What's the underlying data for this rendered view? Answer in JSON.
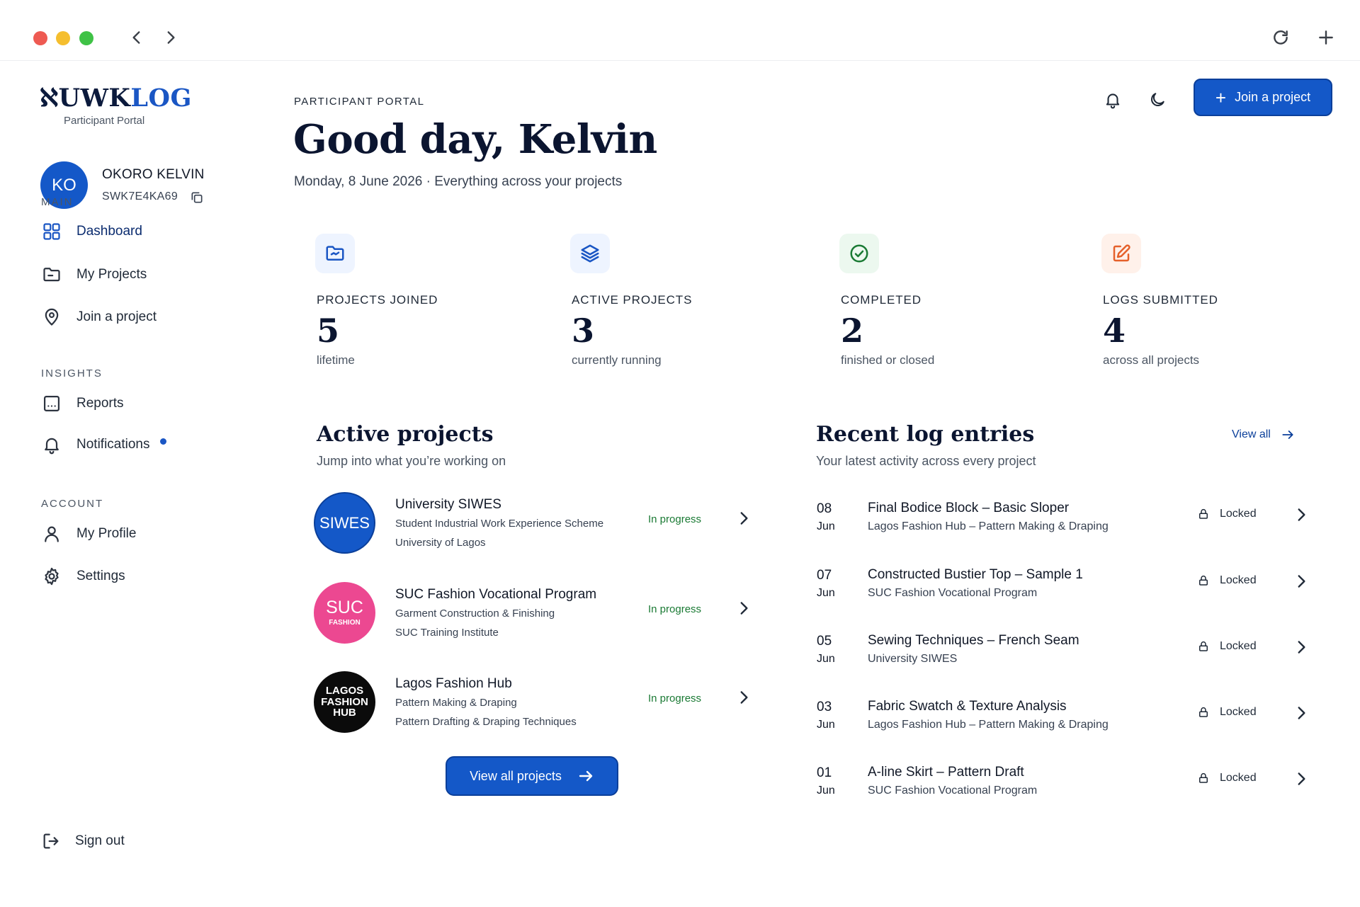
{
  "browser": {
    "icons": {
      "back": "chevron-left-icon",
      "forward": "chevron-right-icon",
      "reload": "reload-icon",
      "new_tab": "plus-icon"
    }
  },
  "brand": {
    "logo_lead": "ℵ",
    "logo_tail_a": "UWK",
    "logo_tail_b": "LOG",
    "subtitle": "Participant Portal"
  },
  "profile": {
    "initials": "KO",
    "name": "OKORO KELVIN",
    "id": "SWK7E4KA69"
  },
  "sidebar": {
    "sections": [
      {
        "label": "MAIN",
        "items": [
          {
            "label": "Dashboard",
            "icon": "grid-icon",
            "active": true
          },
          {
            "label": "My Projects",
            "icon": "folder-icon"
          },
          {
            "label": "Join a project",
            "icon": "map-pin-icon"
          }
        ]
      },
      {
        "label": "INSIGHTS",
        "items": [
          {
            "label": "Reports",
            "icon": "report-icon"
          },
          {
            "label": "Notifications",
            "icon": "bell-icon",
            "has_badge": true
          }
        ]
      },
      {
        "label": "ACCOUNT",
        "items": [
          {
            "label": "My Profile",
            "icon": "user-icon"
          },
          {
            "label": "Settings",
            "icon": "gear-icon"
          }
        ]
      }
    ],
    "sign_out": "Sign out"
  },
  "header": {
    "eyebrow": "PARTICIPANT PORTAL",
    "greeting": "Good day, Kelvin",
    "date_line": "Monday, 8 June 2026 · Everything across your projects",
    "join_button": "Join a project"
  },
  "stats": [
    {
      "label": "PROJECTS JOINED",
      "value": "5",
      "sub": "lifetime",
      "icon": "folder-icon",
      "color": "#1a56c4",
      "bg": "#eef4ff"
    },
    {
      "label": "ACTIVE PROJECTS",
      "value": "3",
      "sub": "currently running",
      "icon": "layers-icon",
      "color": "#1a56c4",
      "bg": "#eef4ff"
    },
    {
      "label": "COMPLETED",
      "value": "2",
      "sub": "finished or closed",
      "icon": "check-circle-icon",
      "color": "#1a7a34",
      "bg": "#ecf8ef"
    },
    {
      "label": "LOGS SUBMITTED",
      "value": "4",
      "sub": "across all projects",
      "icon": "edit-icon",
      "color": "#e5612b",
      "bg": "#fff1ea"
    }
  ],
  "active_projects": {
    "title": "Active projects",
    "subtitle": "Jump into what you’re working on",
    "items": [
      {
        "logo_line1": "SIWES",
        "logo_line2": "",
        "logo_line3": "",
        "logo_bg": "#1458c8",
        "title": "University SIWES",
        "line1": "Student Industrial Work Experience Scheme",
        "line2": "University of Lagos",
        "status": "In progress"
      },
      {
        "logo_line1": "SUC",
        "logo_line2": "FASHION",
        "logo_line3": "",
        "logo_bg": "#ec4891",
        "title": "SUC Fashion Vocational Program",
        "line1": "Garment Construction & Finishing",
        "line2": "SUC Training Institute",
        "status": "In progress"
      },
      {
        "logo_line1": "LAGOS",
        "logo_line2": "FASHION",
        "logo_line3": "HUB",
        "logo_bg": "#0b0b0b",
        "title": "Lagos Fashion Hub",
        "line1": "Pattern Making & Draping",
        "line2": "Pattern Drafting & Draping Techniques",
        "status": "In progress"
      }
    ],
    "view_all": "View all projects"
  },
  "recent_logs": {
    "title": "Recent log entries",
    "subtitle": "Your latest activity across every project",
    "view_all": "View all",
    "items": [
      {
        "day": "08",
        "month": "Jun",
        "title": "Final Bodice Block – Basic Sloper",
        "sub": "Lagos Fashion Hub – Pattern Making & Draping",
        "status": "Locked"
      },
      {
        "day": "07",
        "month": "Jun",
        "title": "Constructed Bustier Top – Sample 1",
        "sub": "SUC Fashion Vocational Program",
        "status": "Locked"
      },
      {
        "day": "05",
        "month": "Jun",
        "title": "Sewing Techniques – French Seam",
        "sub": "University SIWES",
        "status": "Locked"
      },
      {
        "day": "03",
        "month": "Jun",
        "title": "Fabric Swatch & Texture Analysis",
        "sub": "Lagos Fashion Hub – Pattern Making & Draping",
        "status": "Locked"
      },
      {
        "day": "01",
        "month": "Jun",
        "title": "A-line Skirt – Pattern Draft",
        "sub": "SUC Fashion Vocational Program",
        "status": "Locked"
      }
    ]
  },
  "colors": {
    "primary": "#1458c8",
    "primary_dark": "#0b3f9a",
    "status_green": "#1a7a34",
    "heading": "#0b1530"
  }
}
